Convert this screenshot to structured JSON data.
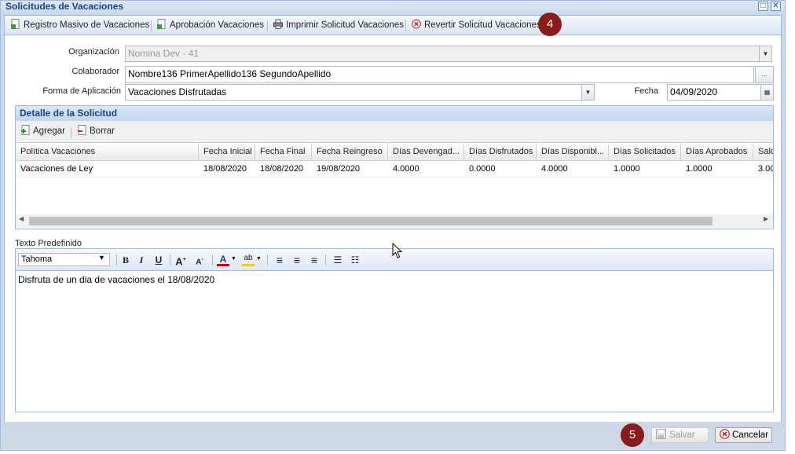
{
  "window": {
    "title": "Solicitudes de Vacaciones",
    "restore_glyph": "□",
    "close_glyph": "✕"
  },
  "toolbar": {
    "bulk_label": "Registro Masivo de Vacaciones",
    "approve_label": "Aprobación Vacaciones",
    "print_label": "Imprimir Solicitud Vacaciones",
    "revert_label": "Revertir Solicitud Vacaciones",
    "callout_number": "4"
  },
  "form": {
    "organizacion_label": "Organización",
    "organizacion_value": "Nomina Dev - 41",
    "colaborador_label": "Colaborador",
    "colaborador_value": "Nombre136 PrimerApellido136 SegundoApellido",
    "colaborador_browse": "...",
    "forma_label": "Forma de Aplicación",
    "forma_value": "Vacaciones Disfrutadas",
    "fecha_label": "Fecha",
    "fecha_value": "04/09/2020"
  },
  "detail": {
    "title": "Detalle de la Solicitud",
    "add_label": "Agregar",
    "delete_label": "Borrar",
    "columns": [
      "Política Vacaciones",
      "Fecha Inicial",
      "Fecha Final",
      "Fecha Reingreso",
      "Días Devengad...",
      "Días Disfrutados",
      "Días Disponibl...",
      "Días Solicitados",
      "Días Aprobados",
      "Sald"
    ],
    "rows": [
      [
        "Vacaciones de Ley",
        "18/08/2020",
        "18/08/2020",
        "19/08/2020",
        "4.0000",
        "0.0000",
        "4.0000",
        "1.0000",
        "1.0000",
        "3.00"
      ]
    ]
  },
  "editor": {
    "label": "Texto Predefinido",
    "font": "Tahoma",
    "content": "Disfruta de un dia de vacaciones el 18/08/2020"
  },
  "footer": {
    "save_label": "Salvar",
    "cancel_label": "Cancelar",
    "callout_number": "5"
  },
  "colors": {
    "header_text": "#15428b",
    "callout": "#8b1c1c",
    "border": "#99bbe8"
  }
}
